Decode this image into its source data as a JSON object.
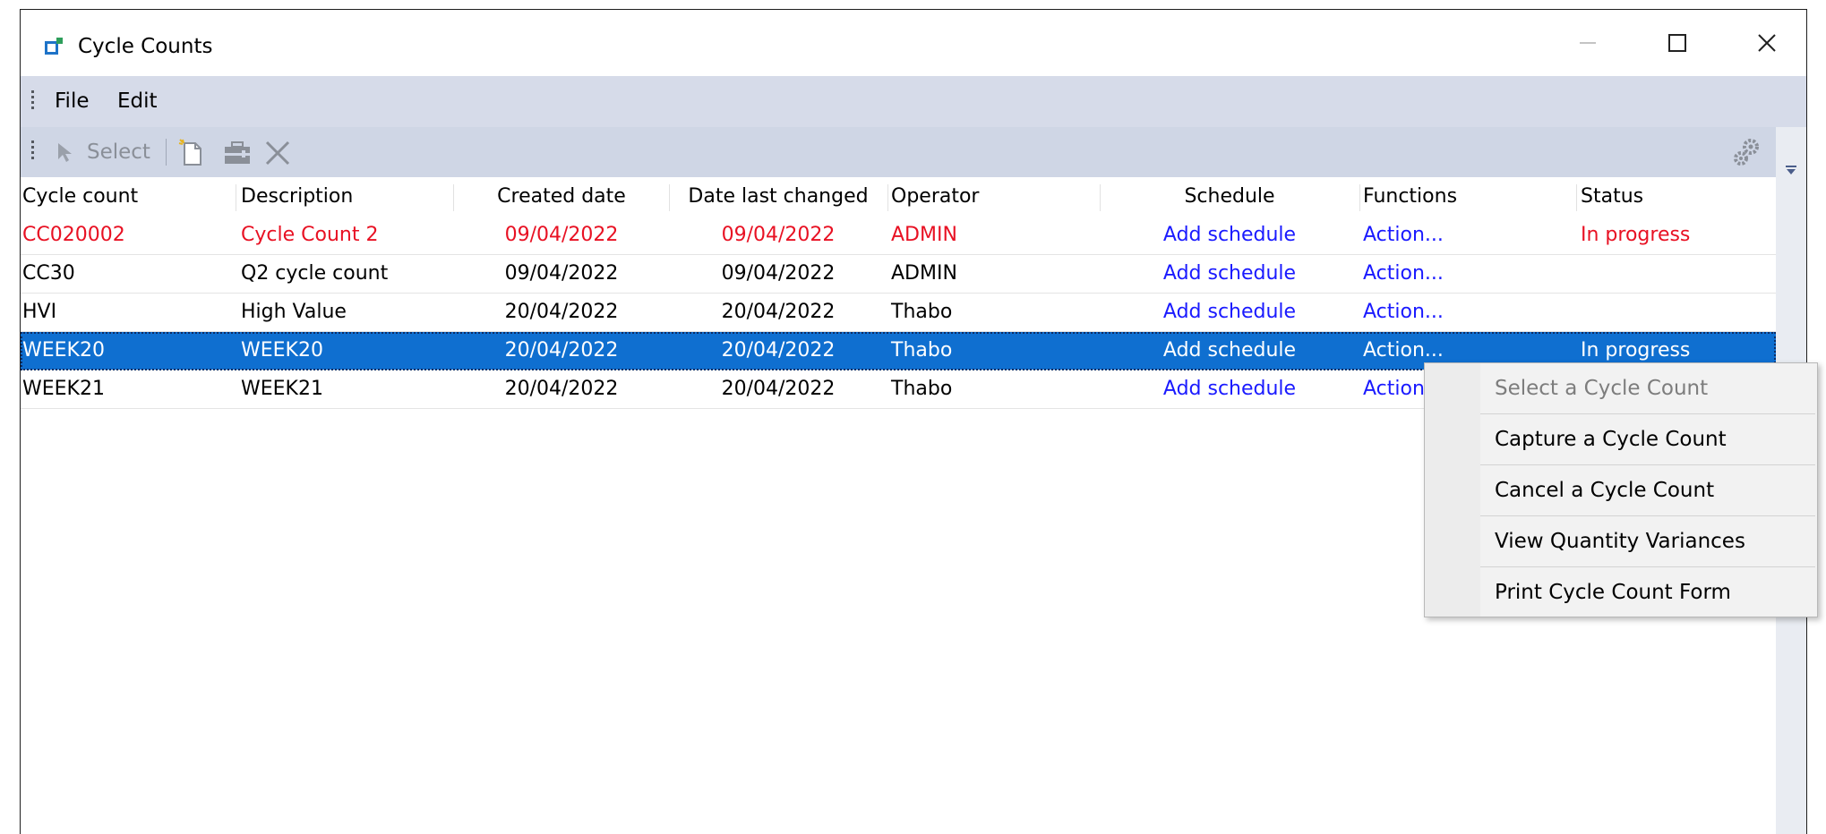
{
  "window": {
    "title": "Cycle Counts",
    "controls": {
      "minimize": "—",
      "maximize": "☐",
      "close": "✕"
    }
  },
  "menubar": {
    "items": [
      "File",
      "Edit"
    ]
  },
  "toolbar": {
    "select_label": "Select"
  },
  "grid": {
    "columns": [
      "Cycle count",
      "Description",
      "Created date",
      "Date last changed",
      "Operator",
      "Schedule",
      "Functions",
      "Status"
    ],
    "rows": [
      {
        "cycle_count": "CC020002",
        "description": "Cycle Count 2",
        "created": "09/04/2022",
        "changed": "09/04/2022",
        "operator": "ADMIN",
        "schedule": "Add schedule",
        "functions": "Action...",
        "status": "In progress"
      },
      {
        "cycle_count": "CC30",
        "description": "Q2 cycle count",
        "created": "09/04/2022",
        "changed": "09/04/2022",
        "operator": "ADMIN",
        "schedule": "Add schedule",
        "functions": "Action...",
        "status": ""
      },
      {
        "cycle_count": "HVI",
        "description": "High Value",
        "created": "20/04/2022",
        "changed": "20/04/2022",
        "operator": "Thabo",
        "schedule": "Add schedule",
        "functions": "Action...",
        "status": ""
      },
      {
        "cycle_count": "WEEK20",
        "description": "WEEK20",
        "created": "20/04/2022",
        "changed": "20/04/2022",
        "operator": "Thabo",
        "schedule": "Add schedule",
        "functions": "Action...",
        "status": "In progress"
      },
      {
        "cycle_count": "WEEK21",
        "description": "WEEK21",
        "created": "20/04/2022",
        "changed": "20/04/2022",
        "operator": "Thabo",
        "schedule": "Add schedule",
        "functions": "Action",
        "status": ""
      }
    ]
  },
  "context_menu": {
    "items": [
      {
        "label": "Select a Cycle Count",
        "disabled": true
      },
      {
        "label": "Capture a Cycle Count",
        "disabled": false
      },
      {
        "label": "Cancel a Cycle Count",
        "disabled": false
      },
      {
        "label": "View Quantity Variances",
        "disabled": false
      },
      {
        "label": "Print Cycle Count Form",
        "disabled": false
      }
    ]
  },
  "colors": {
    "accent_selection": "#0f6fd0",
    "highlight_row_text": "#e81123",
    "link_text": "#1a1aff",
    "menubar_bg": "#d6dbe9",
    "toolbar_bg": "#cfd6e5",
    "app_icon_green": "#2e9e5b",
    "app_icon_blue": "#1e73c8"
  },
  "icons": {
    "app": "cycle-counts-app-icon",
    "select": "cursor-arrow-icon",
    "new": "new-document-icon",
    "toolbox": "toolbox-icon",
    "delete": "delete-x-icon",
    "settings": "gears-icon"
  }
}
